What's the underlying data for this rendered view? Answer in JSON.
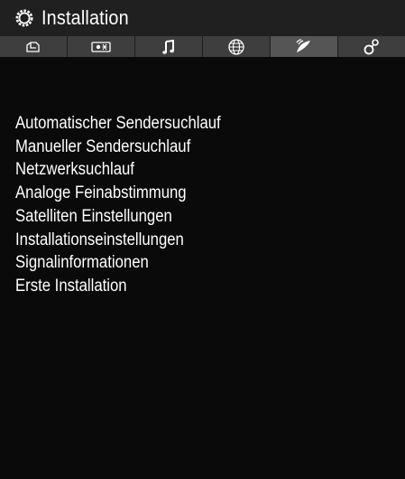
{
  "header": {
    "title": "Installation",
    "icon": "gear-icon"
  },
  "tabs": [
    {
      "icon": "picture-icon",
      "active": false
    },
    {
      "icon": "display-settings-icon",
      "active": false
    },
    {
      "icon": "music-note-icon",
      "active": false
    },
    {
      "icon": "globe-icon",
      "active": false
    },
    {
      "icon": "satellite-dish-icon",
      "active": true
    },
    {
      "icon": "settings-icon",
      "active": false
    }
  ],
  "menu": {
    "items": [
      "Automatischer Sendersuchlauf",
      "Manueller Sendersuchlauf",
      "Netzwerksuchlauf",
      "Analoge Feinabstimmung",
      "Satelliten Einstellungen",
      "Installationseinstellungen",
      "Signalinformationen",
      "Erste Installation"
    ]
  },
  "colors": {
    "background": "#0a0a0a",
    "header": "#202020",
    "tabbar": "#3e3e3e",
    "tab_active": "#555555",
    "text": "#ffffff"
  }
}
